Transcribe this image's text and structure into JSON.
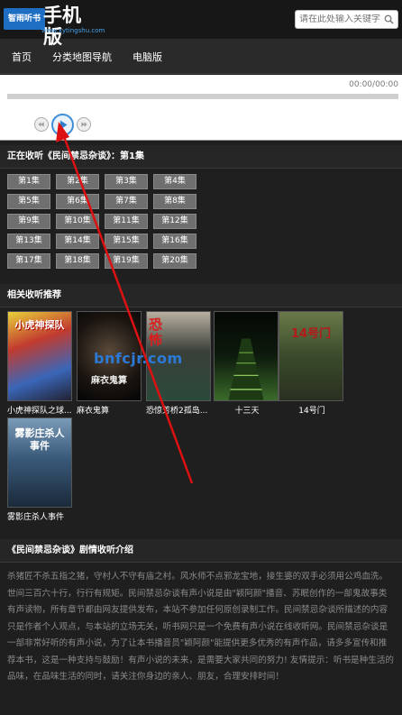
{
  "header": {
    "logo_badge": "智雨听书",
    "logo_title": "手机版",
    "logo_url": "www.xytingshu.com",
    "search_placeholder": "请在此处输入关键字"
  },
  "nav": {
    "items": [
      "首页",
      "分类地图导航",
      "电脑版"
    ]
  },
  "player": {
    "time": "00:00/00:00",
    "progress": 0
  },
  "episodes": {
    "title": "正在收听《民间禁忌杂谈》：第1集",
    "items": [
      "第1集",
      "第2集",
      "第3集",
      "第4集",
      "第5集",
      "第6集",
      "第7集",
      "第8集",
      "第9集",
      "第10集",
      "第11集",
      "第12集",
      "第13集",
      "第14集",
      "第15集",
      "第16集",
      "第17集",
      "第18集",
      "第19集",
      "第20集"
    ]
  },
  "related": {
    "title": "相关收听推荐",
    "books": [
      {
        "label": "小虎神探队之球...",
        "cover_text": "小虎神探队"
      },
      {
        "label": "麻衣鬼算",
        "cover_text": "麻衣鬼算"
      },
      {
        "label": "恐惊芳桥2孤岛...",
        "cover_text": "恐怖"
      },
      {
        "label": "十三天",
        "cover_text": ""
      },
      {
        "label": "14号门",
        "cover_text": "14号门"
      },
      {
        "label": "雾影庄杀人事件",
        "cover_text": "雾影庄杀人事件"
      }
    ]
  },
  "watermark": "bnfcjr.com",
  "intro": {
    "title": "《民间禁忌杂谈》剧情收听介绍",
    "body": "杀猪匠不杀五指之猪，守村人不守有庙之村。风水师不点邪龙宝地，接生婆的双手必须用公鸡血洗。世间三百六十行，行行有规矩。民间禁忌杂谈有声小说是由\"颖阿颜\"播音、苏眠创作的一部鬼故事类有声读物，所有章节都由网友提供发布，本站不参加任何原创录制工作。民间禁忌杂谈所描述的内容只是作者个人观点，与本站的立场无关，听书网只是一个免费有声小说在线收听网。民间禁忌杂谈是一部非常好听的有声小说，为了让本书播音员\"颖阿颜\"能提供更多优秀的有声作品，请多多宣传和推荐本书，这是一种支持与鼓励！有声小说的未来，是需要大家共同的努力! 友情提示：听书是种生活的品味，在品味生活的同时，请关注你身边的亲人、朋友，合理安排时间！"
  },
  "colors": {
    "accent": "#1e6fc4",
    "background": "#1f1f1f",
    "arrow": "#dd1111"
  }
}
